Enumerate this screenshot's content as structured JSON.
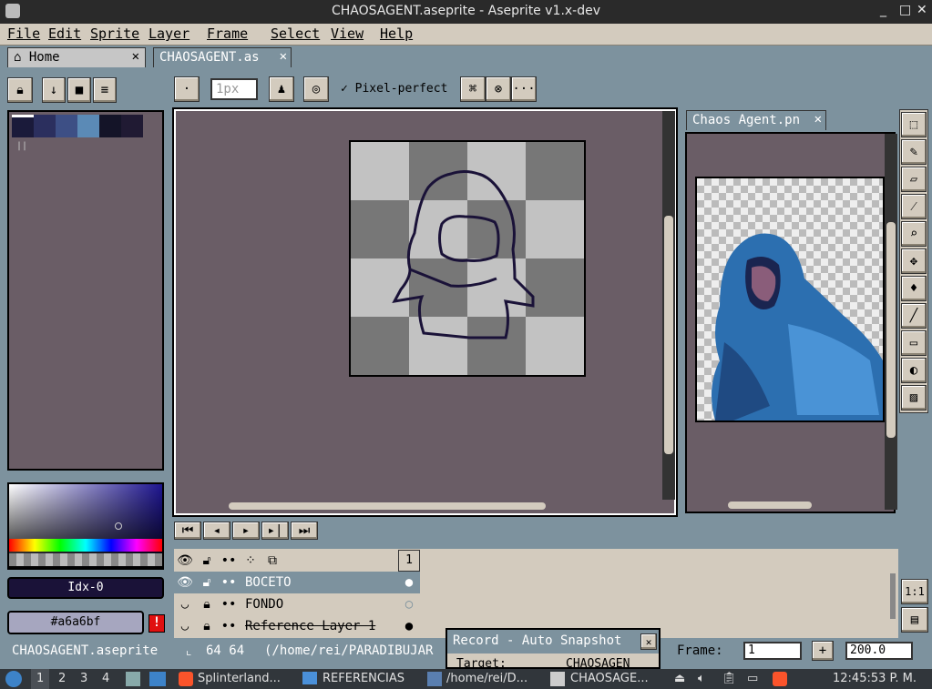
{
  "window": {
    "title": "CHAOSAGENT.aseprite - Aseprite v1.x-dev"
  },
  "menu": [
    "File",
    "Edit",
    "Sprite",
    "Layer",
    "Frame",
    "Select",
    "View",
    "Help"
  ],
  "tabs": {
    "home": "Home",
    "doc": "CHAOSAGENT.as"
  },
  "toolbar": {
    "brush_size": "1px",
    "pixel_perfect": "Pixel-perfect",
    "more": "···"
  },
  "palette": {
    "colors": [
      "#1a1a3a",
      "#2b2f5e",
      "#3d4f85",
      "#5b8ab6",
      "#141428",
      "#201a33"
    ],
    "index": "Idx-0",
    "hex": "#a6a6bf"
  },
  "preview": {
    "title": "Chaos Agent.pn"
  },
  "layers": {
    "frame_number": "1",
    "items": [
      {
        "name": "BOCETO"
      },
      {
        "name": "FONDO"
      },
      {
        "name": "Reference Layer 1"
      }
    ]
  },
  "record": {
    "title": "Record - Auto Snapshot",
    "target_label": "Target:",
    "target_value": "CHAOSAGEN"
  },
  "status": {
    "filename": "CHAOSAGENT.aseprite",
    "size": "64 64",
    "path": "(/home/rei/PARADIBUJAR",
    "frame_label": "Frame:",
    "frame_value": "1",
    "zoom": "200.0"
  },
  "zoom_btn": "1:1",
  "taskbar": {
    "workspaces": [
      "1",
      "2",
      "3",
      "4"
    ],
    "apps": [
      "Splinterland...",
      "REFERENCIAS",
      "/home/rei/D...",
      "CHAOSAGE..."
    ],
    "clock": "12:45:53 P. M."
  }
}
